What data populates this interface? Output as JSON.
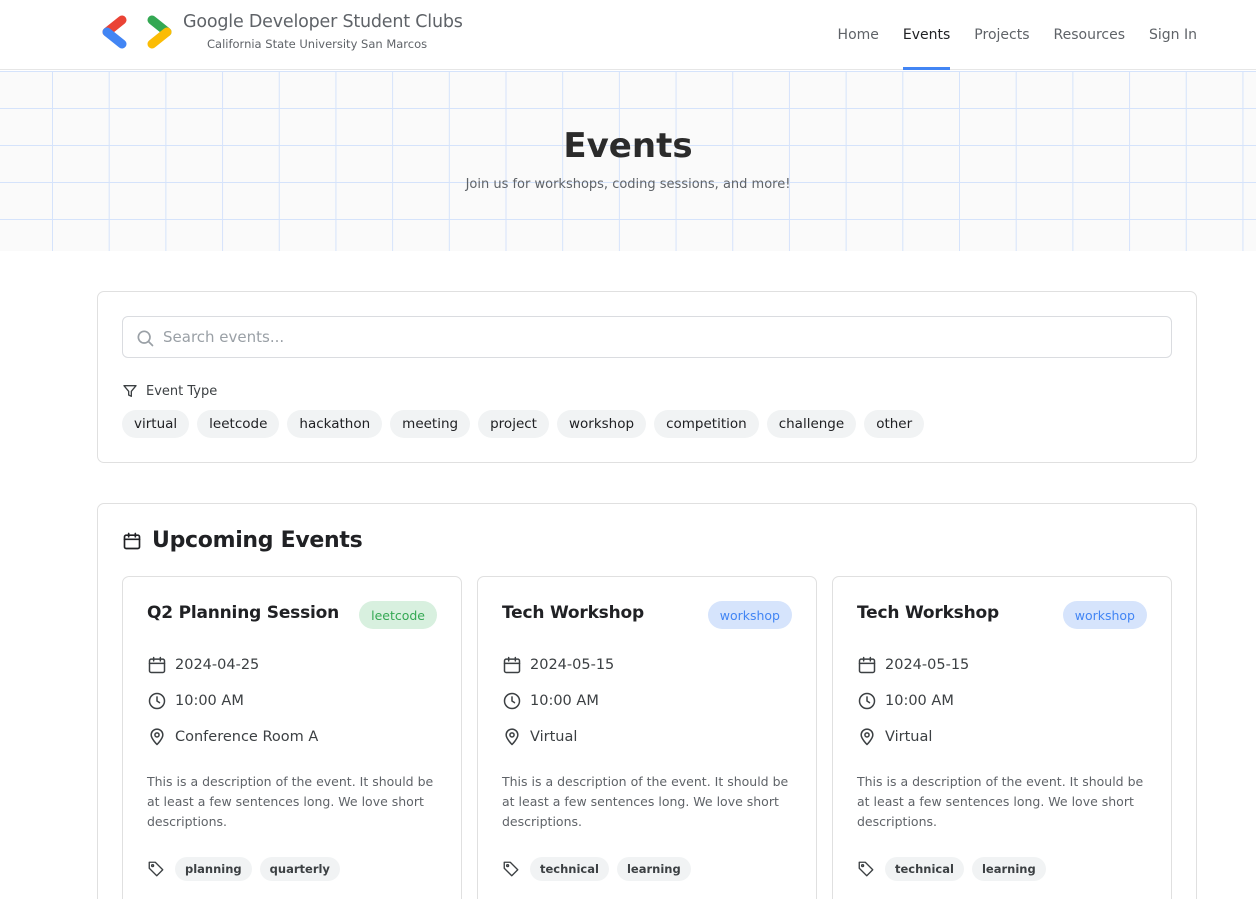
{
  "brand": {
    "title": "Google Developer Student Clubs",
    "subtitle": "California State University San Marcos",
    "logo_icon": "gdsc-brackets-logo",
    "colors": {
      "red": "#ea4335",
      "blue": "#4285f4",
      "green": "#34a853",
      "yellow": "#fbbc04"
    }
  },
  "nav": {
    "items": [
      {
        "label": "Home",
        "active": false
      },
      {
        "label": "Events",
        "active": true
      },
      {
        "label": "Projects",
        "active": false
      },
      {
        "label": "Resources",
        "active": false
      },
      {
        "label": "Sign In",
        "active": false
      }
    ],
    "active_color": "#4285f4"
  },
  "hero": {
    "title": "Events",
    "subtitle": "Join us for workshops, coding sessions, and more!"
  },
  "filter": {
    "search_placeholder": "Search events...",
    "search_value": "",
    "search_icon": "search-icon",
    "type_label": "Event Type",
    "type_icon": "funnel-icon",
    "types": [
      "virtual",
      "leetcode",
      "hackathon",
      "meeting",
      "project",
      "workshop",
      "competition",
      "challenge",
      "other"
    ]
  },
  "events": {
    "section_title": "Upcoming Events",
    "section_icon": "calendar-icon",
    "items": [
      {
        "title": "Q2 Planning Session",
        "type": "leetcode",
        "badge_style": "green",
        "date": "2024-04-25",
        "time": "10:00 AM",
        "location": "Conference Room A",
        "description": "This is a description of the event. It should be at least a few sentences long. We love short descriptions.",
        "tags": [
          "planning",
          "quarterly"
        ]
      },
      {
        "title": "Tech Workshop",
        "type": "workshop",
        "badge_style": "blue",
        "date": "2024-05-15",
        "time": "10:00 AM",
        "location": "Virtual",
        "description": "This is a description of the event. It should be at least a few sentences long. We love short descriptions.",
        "tags": [
          "technical",
          "learning"
        ]
      },
      {
        "title": "Tech Workshop",
        "type": "workshop",
        "badge_style": "blue",
        "date": "2024-05-15",
        "time": "10:00 AM",
        "location": "Virtual",
        "description": "This is a description of the event. It should be at least a few sentences long. We love short descriptions.",
        "tags": [
          "technical",
          "learning"
        ]
      }
    ]
  }
}
